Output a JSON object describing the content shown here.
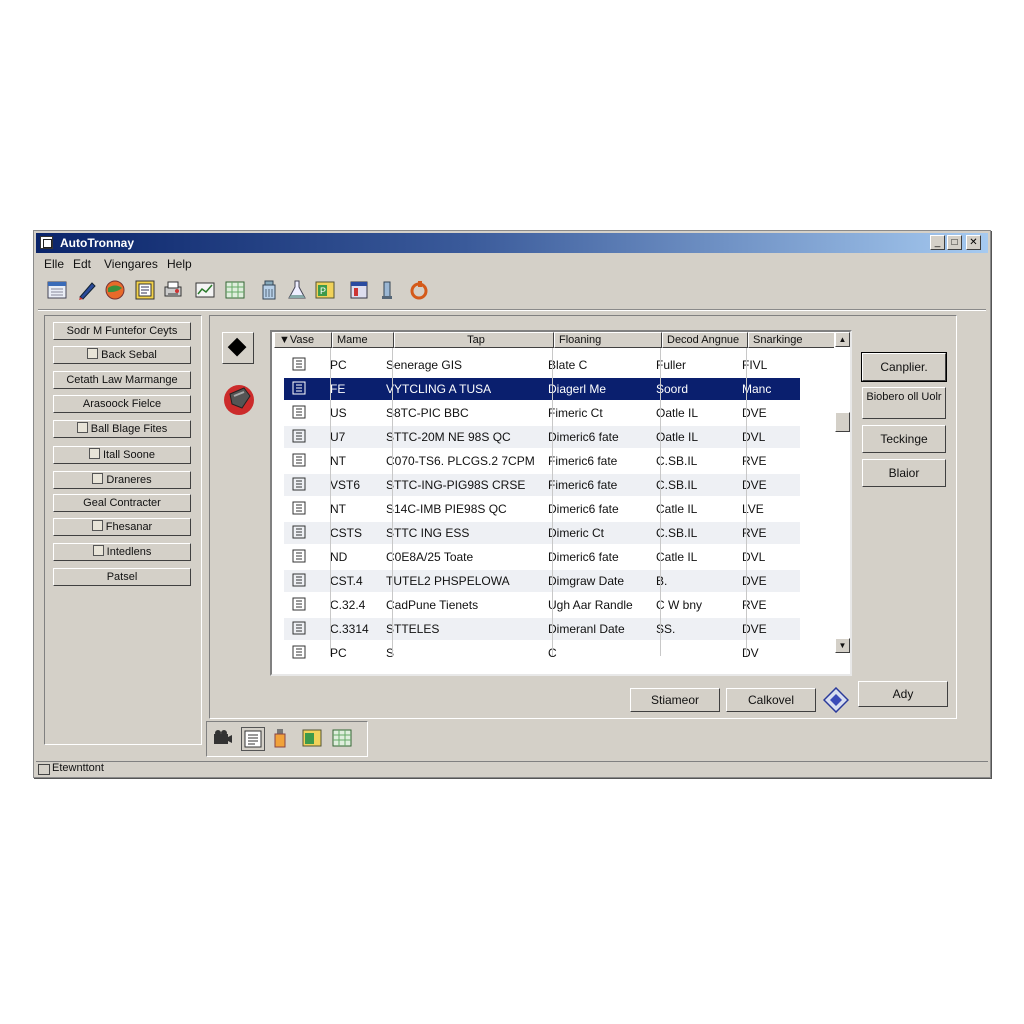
{
  "window": {
    "title": "AutoTronnay"
  },
  "menu": [
    "Elle",
    "Edt",
    "Viengares",
    "Help"
  ],
  "toolbar_icons": [
    "calendar-icon",
    "pen-icon",
    "globe-icon",
    "document-icon",
    "printer-icon",
    "chart-icon",
    "spreadsheet-icon",
    "bottle-icon",
    "flask-icon",
    "publisher-icon",
    "window-icon",
    "gauge-icon",
    "wrench-icon"
  ],
  "sidebar": {
    "items": [
      {
        "label": "Sodr M Funtefor Ceyts",
        "icon": false
      },
      {
        "label": "Back Sebal",
        "icon": true
      },
      {
        "label": "Cetath Law Marmange",
        "icon": false
      },
      {
        "label": "Arasoock Fielce",
        "icon": false
      },
      {
        "label": "Ball Blage Fites",
        "icon": true
      },
      {
        "label": "Itall Soone",
        "icon": true
      },
      {
        "label": "Draneres",
        "icon": true
      },
      {
        "label": "Geal Contracter",
        "icon": false
      },
      {
        "label": "Fhesanar",
        "icon": true
      },
      {
        "label": "Intedlens",
        "icon": true
      },
      {
        "label": "Patsel",
        "icon": false
      }
    ]
  },
  "table": {
    "headers": [
      "Vase",
      "Mame",
      "Tap",
      "Floaning",
      "Decod Angnue",
      "Snarkinge"
    ],
    "rows": [
      [
        "PC",
        "Senerage GIS",
        "Blate C",
        "Fuller",
        "FIVL"
      ],
      [
        "FE",
        "VYTCLING A TUSA",
        "Diagerl Me",
        "Soord",
        "Manc"
      ],
      [
        "US",
        "S8TC-PIC BBC",
        "Fimeric Ct",
        "Oatle IL",
        "DVE"
      ],
      [
        "U7",
        "STTC-20M NE 98S QC",
        "Dimeric6 fate",
        "Oatle IL",
        "DVL"
      ],
      [
        "NT",
        "C070-TS6. PLCGS.2 7CPM",
        "Fimeric6 fate",
        "C.SB.IL",
        "RVE"
      ],
      [
        "VST6",
        "STTC-ING-PIG98S CRSE",
        "Fimeric6 fate",
        "C.SB.IL",
        "DVE"
      ],
      [
        "NT",
        "S14C-IMB PIE98S QC",
        "Dimeric6 fate",
        "Catle IL",
        "LVE"
      ],
      [
        "CSTS",
        "STTC ING ESS",
        "Dimeric Ct",
        "C.SB.IL",
        "RVE"
      ],
      [
        "ND",
        "C0E8A/25 Toate",
        "Dimeric6 fate",
        "Catle IL",
        "DVL"
      ],
      [
        "CST.4",
        "TUTEL2 PHSPELOWA",
        "Dimgraw Date",
        "B.",
        "DVE"
      ],
      [
        "C.32.4",
        "CadPune Tienets",
        "Ugh Aar Randle",
        "C W bny",
        "RVE"
      ],
      [
        "C.3314",
        "STTELES",
        "Dimeranl Date",
        "SS.",
        "DVE"
      ],
      [
        "PC",
        "S",
        "C",
        "",
        "DV"
      ]
    ],
    "selected_row": 1
  },
  "right_buttons": [
    "Canplier.",
    "Biobero oll Uolr",
    "Teckinge",
    "Blaior"
  ],
  "bottom_buttons": {
    "primary": "Stiameor",
    "secondary": "Calkovel",
    "apply": "Ady"
  },
  "status": {
    "text": "Etewnttont"
  }
}
